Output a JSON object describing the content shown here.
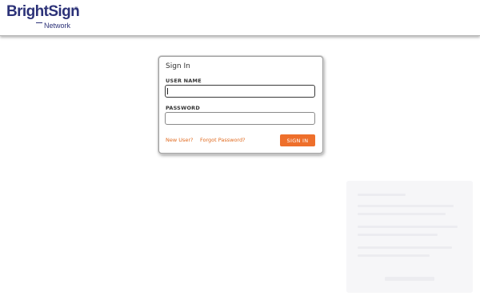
{
  "header": {
    "logo": {
      "brand": "BrightSign",
      "registered": "®",
      "product": "Network"
    }
  },
  "login": {
    "title": "Sign In",
    "username_label": "USER NAME",
    "username_value": "",
    "password_label": "PASSWORD",
    "password_value": "",
    "new_user_link": "New User?",
    "forgot_password_link": "Forgot Password?",
    "sign_in_button": "SIGN IN"
  },
  "colors": {
    "brand": "#2c3278",
    "accent": "#ee6f2b",
    "link": "#e06a1f"
  }
}
